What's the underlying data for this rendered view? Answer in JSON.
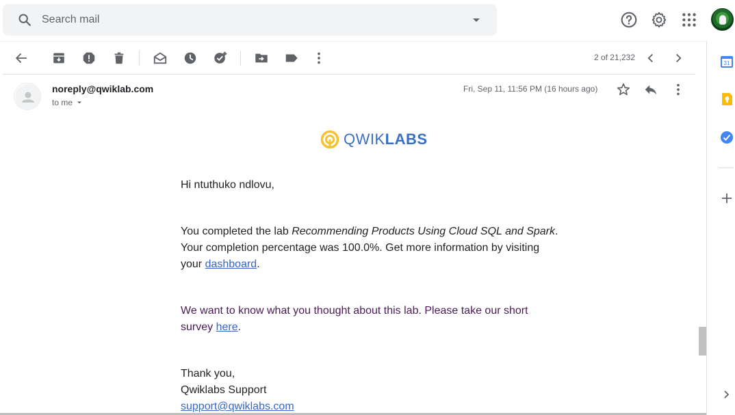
{
  "search": {
    "placeholder": "Search mail",
    "icon": "search-icon",
    "options_icon": "dropdown-arrow-icon"
  },
  "top_bar": {
    "icons": [
      "help-icon",
      "settings-gear-icon",
      "apps-grid-icon"
    ],
    "avatar": "account-avatar"
  },
  "toolbar": {
    "icons": [
      "back-arrow-icon",
      "archive-icon",
      "report-spam-icon",
      "delete-icon",
      "mark-unread-icon",
      "snooze-icon",
      "add-to-tasks-icon",
      "move-to-icon",
      "label-icon",
      "more-vert-icon"
    ],
    "pager": "2 of 21,232",
    "pager_icons": [
      "chevron-left-icon",
      "chevron-right-icon"
    ]
  },
  "message": {
    "sender": "noreply@qwiklab.com",
    "to": "to me",
    "date": "Fri, Sep 11, 11:56 PM (16 hours ago)",
    "icons": [
      "star-icon",
      "reply-icon",
      "more-vert-icon"
    ]
  },
  "email": {
    "logo_text_light": "QWIK",
    "logo_text_bold": "LABS",
    "greeting": "Hi ntuthuko ndlovu,",
    "p1_a": "You completed the lab ",
    "p1_lab": "Recommending Products Using Cloud SQL and Spark",
    "p1_b": ".",
    "p1_line2": "Your completion percentage was 100.0%. Get more information by visiting",
    "p1_line3_a": "your ",
    "p1_link": "dashboard",
    "p1_line3_b": ".",
    "p2_line1": "We want to know what you thought about this lab. Please take our short",
    "p2_line2_a": "survey ",
    "p2_link": "here",
    "p2_line2_b": ".",
    "closing": "Thank you,",
    "signature": "Qwiklabs Support",
    "support_email": "support@qwiklabs.com"
  },
  "side_panel": {
    "icons": [
      "calendar-icon",
      "keep-icon",
      "tasks-icon",
      "add-icon",
      "expand-chevron-icon"
    ],
    "calendar_day": "31"
  },
  "colors": {
    "link": "#3366cc",
    "logo_blue": "#3b6fc4",
    "logo_yellow": "#f6c230",
    "survey_text": "#4a1a55"
  }
}
